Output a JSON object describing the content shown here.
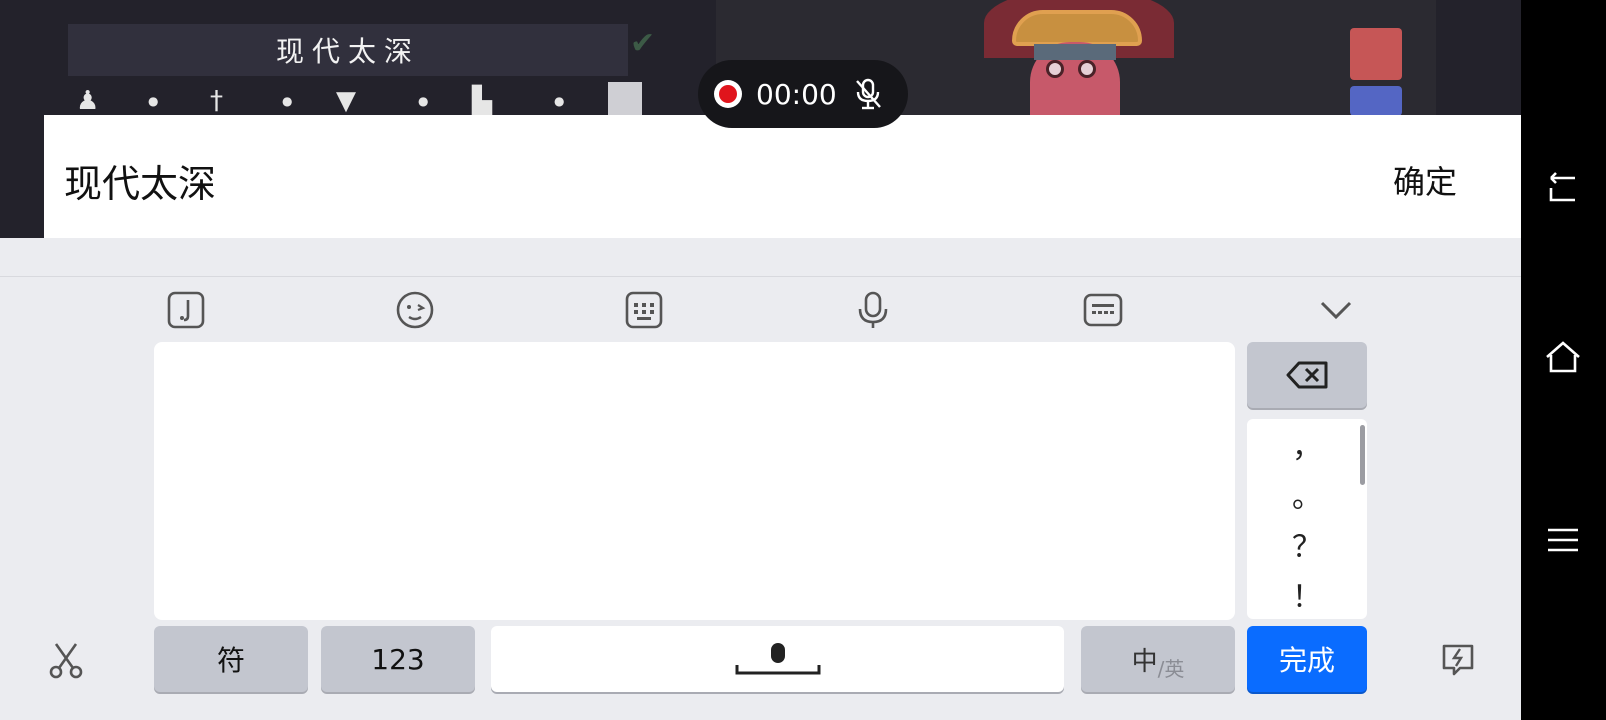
{
  "game": {
    "name_value": "现代太深",
    "check_icon": "check-icon",
    "row_icons": [
      "person-icon",
      "sword-icon",
      "shirt-icon",
      "stats-icon",
      "save-icon"
    ],
    "swatch_colors": [
      "#c65656",
      "#5466c4"
    ]
  },
  "recorder": {
    "time": "00:00",
    "record_icon": "record-dot-icon",
    "mic_icon": "mic-muted-icon"
  },
  "input_header": {
    "text": "现代太深",
    "confirm_label": "确定"
  },
  "keyboard": {
    "toolbar": [
      {
        "name": "music-icon"
      },
      {
        "name": "emoji-icon"
      },
      {
        "name": "keyboard-layout-icon"
      },
      {
        "name": "microphone-icon"
      },
      {
        "name": "subtitle-keyboard-icon"
      },
      {
        "name": "collapse-chevron-icon"
      }
    ],
    "backspace_icon": "backspace-icon",
    "punctuation": [
      "，",
      "。",
      "？",
      "！"
    ],
    "symbol_label": "符",
    "number_label": "123",
    "space_icon": "space-mic-icon",
    "lang_main": "中",
    "lang_sub": "/英",
    "done_label": "完成",
    "scissors_icon": "scissors-icon",
    "quick_reply_icon": "quick-reply-icon"
  },
  "navbar": {
    "back_icon": "back-icon",
    "home_icon": "home-icon",
    "menu_icon": "menu-icon"
  }
}
